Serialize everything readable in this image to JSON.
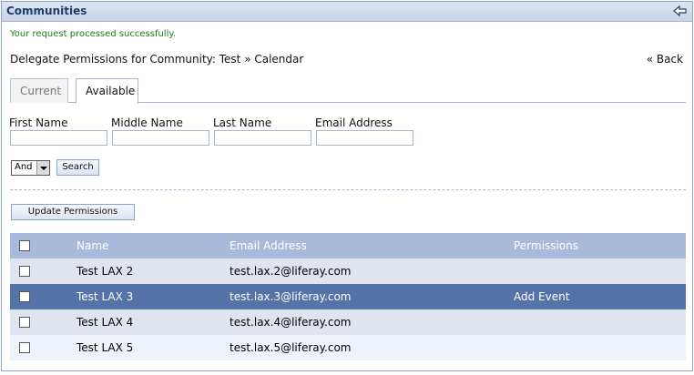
{
  "portlet": {
    "title": "Communities"
  },
  "message": {
    "success": "Your request processed successfully."
  },
  "page": {
    "heading": "Delegate Permissions for Community: Test » Calendar",
    "back_link": "« Back"
  },
  "tabs": [
    {
      "label": "Current",
      "active": false
    },
    {
      "label": "Available",
      "active": true
    }
  ],
  "search_form": {
    "fields": [
      {
        "label": "First Name",
        "value": ""
      },
      {
        "label": "Middle Name",
        "value": ""
      },
      {
        "label": "Last Name",
        "value": ""
      },
      {
        "label": "Email Address",
        "value": ""
      }
    ],
    "operator": "And",
    "search_button": "Search"
  },
  "actions": {
    "update_button": "Update Permissions"
  },
  "table": {
    "columns": [
      "",
      "Name",
      "Email Address",
      "Permissions"
    ],
    "rows": [
      {
        "name": "Test LAX 2",
        "email": "test.lax.2@liferay.com",
        "permissions": "",
        "selected": false
      },
      {
        "name": "Test LAX 3",
        "email": "test.lax.3@liferay.com",
        "permissions": "Add Event",
        "selected": true
      },
      {
        "name": "Test LAX 4",
        "email": "test.lax.4@liferay.com",
        "permissions": "",
        "selected": false
      },
      {
        "name": "Test LAX 5",
        "email": "test.lax.5@liferay.com",
        "permissions": "",
        "selected": false
      }
    ]
  },
  "icons": {
    "back_arrow": "back-arrow-icon",
    "dropdown": "chevron-down-icon"
  },
  "colors": {
    "header": "#a9b9d9",
    "selected_row": "#5473a9",
    "success": "#1c7b18"
  }
}
